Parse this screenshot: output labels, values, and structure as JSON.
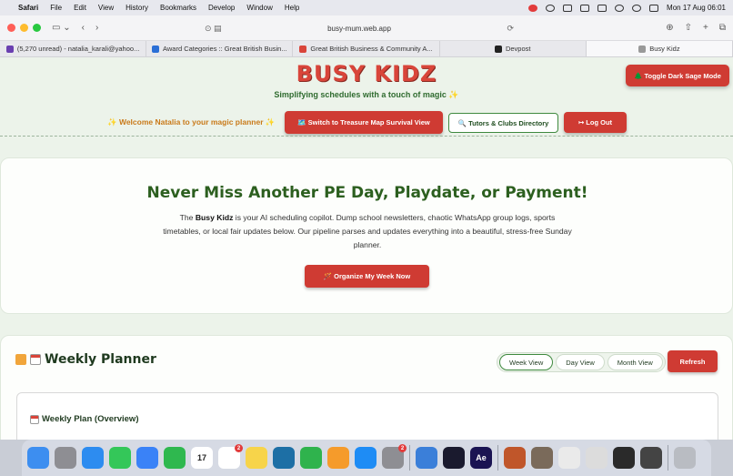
{
  "menubar": {
    "items": [
      "Safari",
      "File",
      "Edit",
      "View",
      "History",
      "Bookmarks",
      "Develop",
      "Window",
      "Help"
    ],
    "datetime": "Mon 17 Aug  06:01"
  },
  "browser": {
    "url": "busy-mum.web.app",
    "tabs": [
      {
        "label": "(5,270 unread) - natalia_karali@yahoo...",
        "color": "#6a3fb0"
      },
      {
        "label": "Award Categories :: Great British Busin...",
        "color": "#2b6fd6"
      },
      {
        "label": "Great British Business & Community A...",
        "color": "#d9453a"
      },
      {
        "label": "Devpost",
        "color": "#222222"
      },
      {
        "label": "Busy Kidz",
        "color": "#999999"
      }
    ]
  },
  "header": {
    "logo": "BUSY KIDZ",
    "tagline": "Simplifying schedules with a touch of magic ✨",
    "dark_mode_label": "🌲 Toggle Dark Sage Mode",
    "welcome": "✨ Welcome Natalia to your magic planner ✨",
    "treasure_label": "🗺️ Switch to Treasure Map Survival View",
    "tutors_label": "🔍 Tutors & Clubs Directory",
    "logout_label": "↦ Log Out"
  },
  "hero": {
    "title": "Never Miss Another PE Day, Playdate, or Payment!",
    "desc_prefix": "The ",
    "desc_brand": "Busy Kidz",
    "desc_rest": " is your AI scheduling copilot. Dump school newsletters, chaotic WhatsApp group logs, sports timetables, or local fair updates below. Our pipeline parses and updates everything into a beautiful, stress-free Sunday planner.",
    "cta_label": "🪄 Organize My Week Now"
  },
  "planner": {
    "title": "Weekly Planner",
    "views": [
      "Week View",
      "Day View",
      "Month View"
    ],
    "active_view": "Week View",
    "refresh_label": "Refresh",
    "overview_title": "Weekly Plan (Overview)"
  },
  "dock": {
    "apps": [
      {
        "name": "finder",
        "color": "#3d8ef0"
      },
      {
        "name": "launchpad",
        "color": "#8e8e93"
      },
      {
        "name": "safari",
        "color": "#2d8cf0"
      },
      {
        "name": "messages",
        "color": "#34c759"
      },
      {
        "name": "mail",
        "color": "#3a82f7"
      },
      {
        "name": "facetime",
        "color": "#2fb84f"
      },
      {
        "name": "calendar",
        "color": "#ffffff",
        "text": "17"
      },
      {
        "name": "reminders",
        "color": "#ffffff",
        "badge": "2"
      },
      {
        "name": "notes",
        "color": "#f7d44a"
      },
      {
        "name": "freeform",
        "color": "#1d6fa5"
      },
      {
        "name": "numbers",
        "color": "#2fb34d"
      },
      {
        "name": "pages",
        "color": "#f59b2b"
      },
      {
        "name": "app-store",
        "color": "#1e8cf5"
      },
      {
        "name": "system-settings",
        "color": "#8e8e93",
        "badge": "2"
      },
      {
        "name": "quicktime",
        "color": "#3b7fd9"
      },
      {
        "name": "arc",
        "color": "#1a1a2e"
      },
      {
        "name": "after-effects",
        "color": "#1a1352",
        "text": "Ae"
      },
      {
        "name": "photo-1",
        "color": "#c0562a"
      },
      {
        "name": "photo-2",
        "color": "#7a6a5a"
      },
      {
        "name": "doc-1",
        "color": "#eaeaea"
      },
      {
        "name": "doc-2",
        "color": "#dcdcdc"
      },
      {
        "name": "doc-3",
        "color": "#2a2a2a"
      },
      {
        "name": "doc-4",
        "color": "#444444"
      },
      {
        "name": "trash",
        "color": "#b9bcc2"
      }
    ]
  }
}
